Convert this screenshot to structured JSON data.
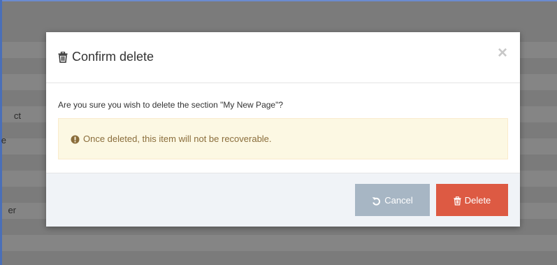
{
  "background": {
    "fragments": [
      "ct",
      "e",
      "er"
    ]
  },
  "modal": {
    "title": "Confirm delete",
    "close_label": "×",
    "question": "Are you sure you wish to delete the section \"My New Page\"?",
    "warning": "Once deleted, this item will not be recoverable.",
    "cancel_label": "Cancel",
    "delete_label": "Delete"
  },
  "colors": {
    "cancel_button": "#a7b6c4",
    "delete_button": "#dd5a43",
    "warning_bg": "#fcf8e3",
    "warning_text": "#8a6d3b"
  },
  "icons": {
    "title": "trash-icon",
    "warning": "exclamation-circle-icon",
    "cancel": "undo-icon",
    "delete": "trash-icon"
  }
}
